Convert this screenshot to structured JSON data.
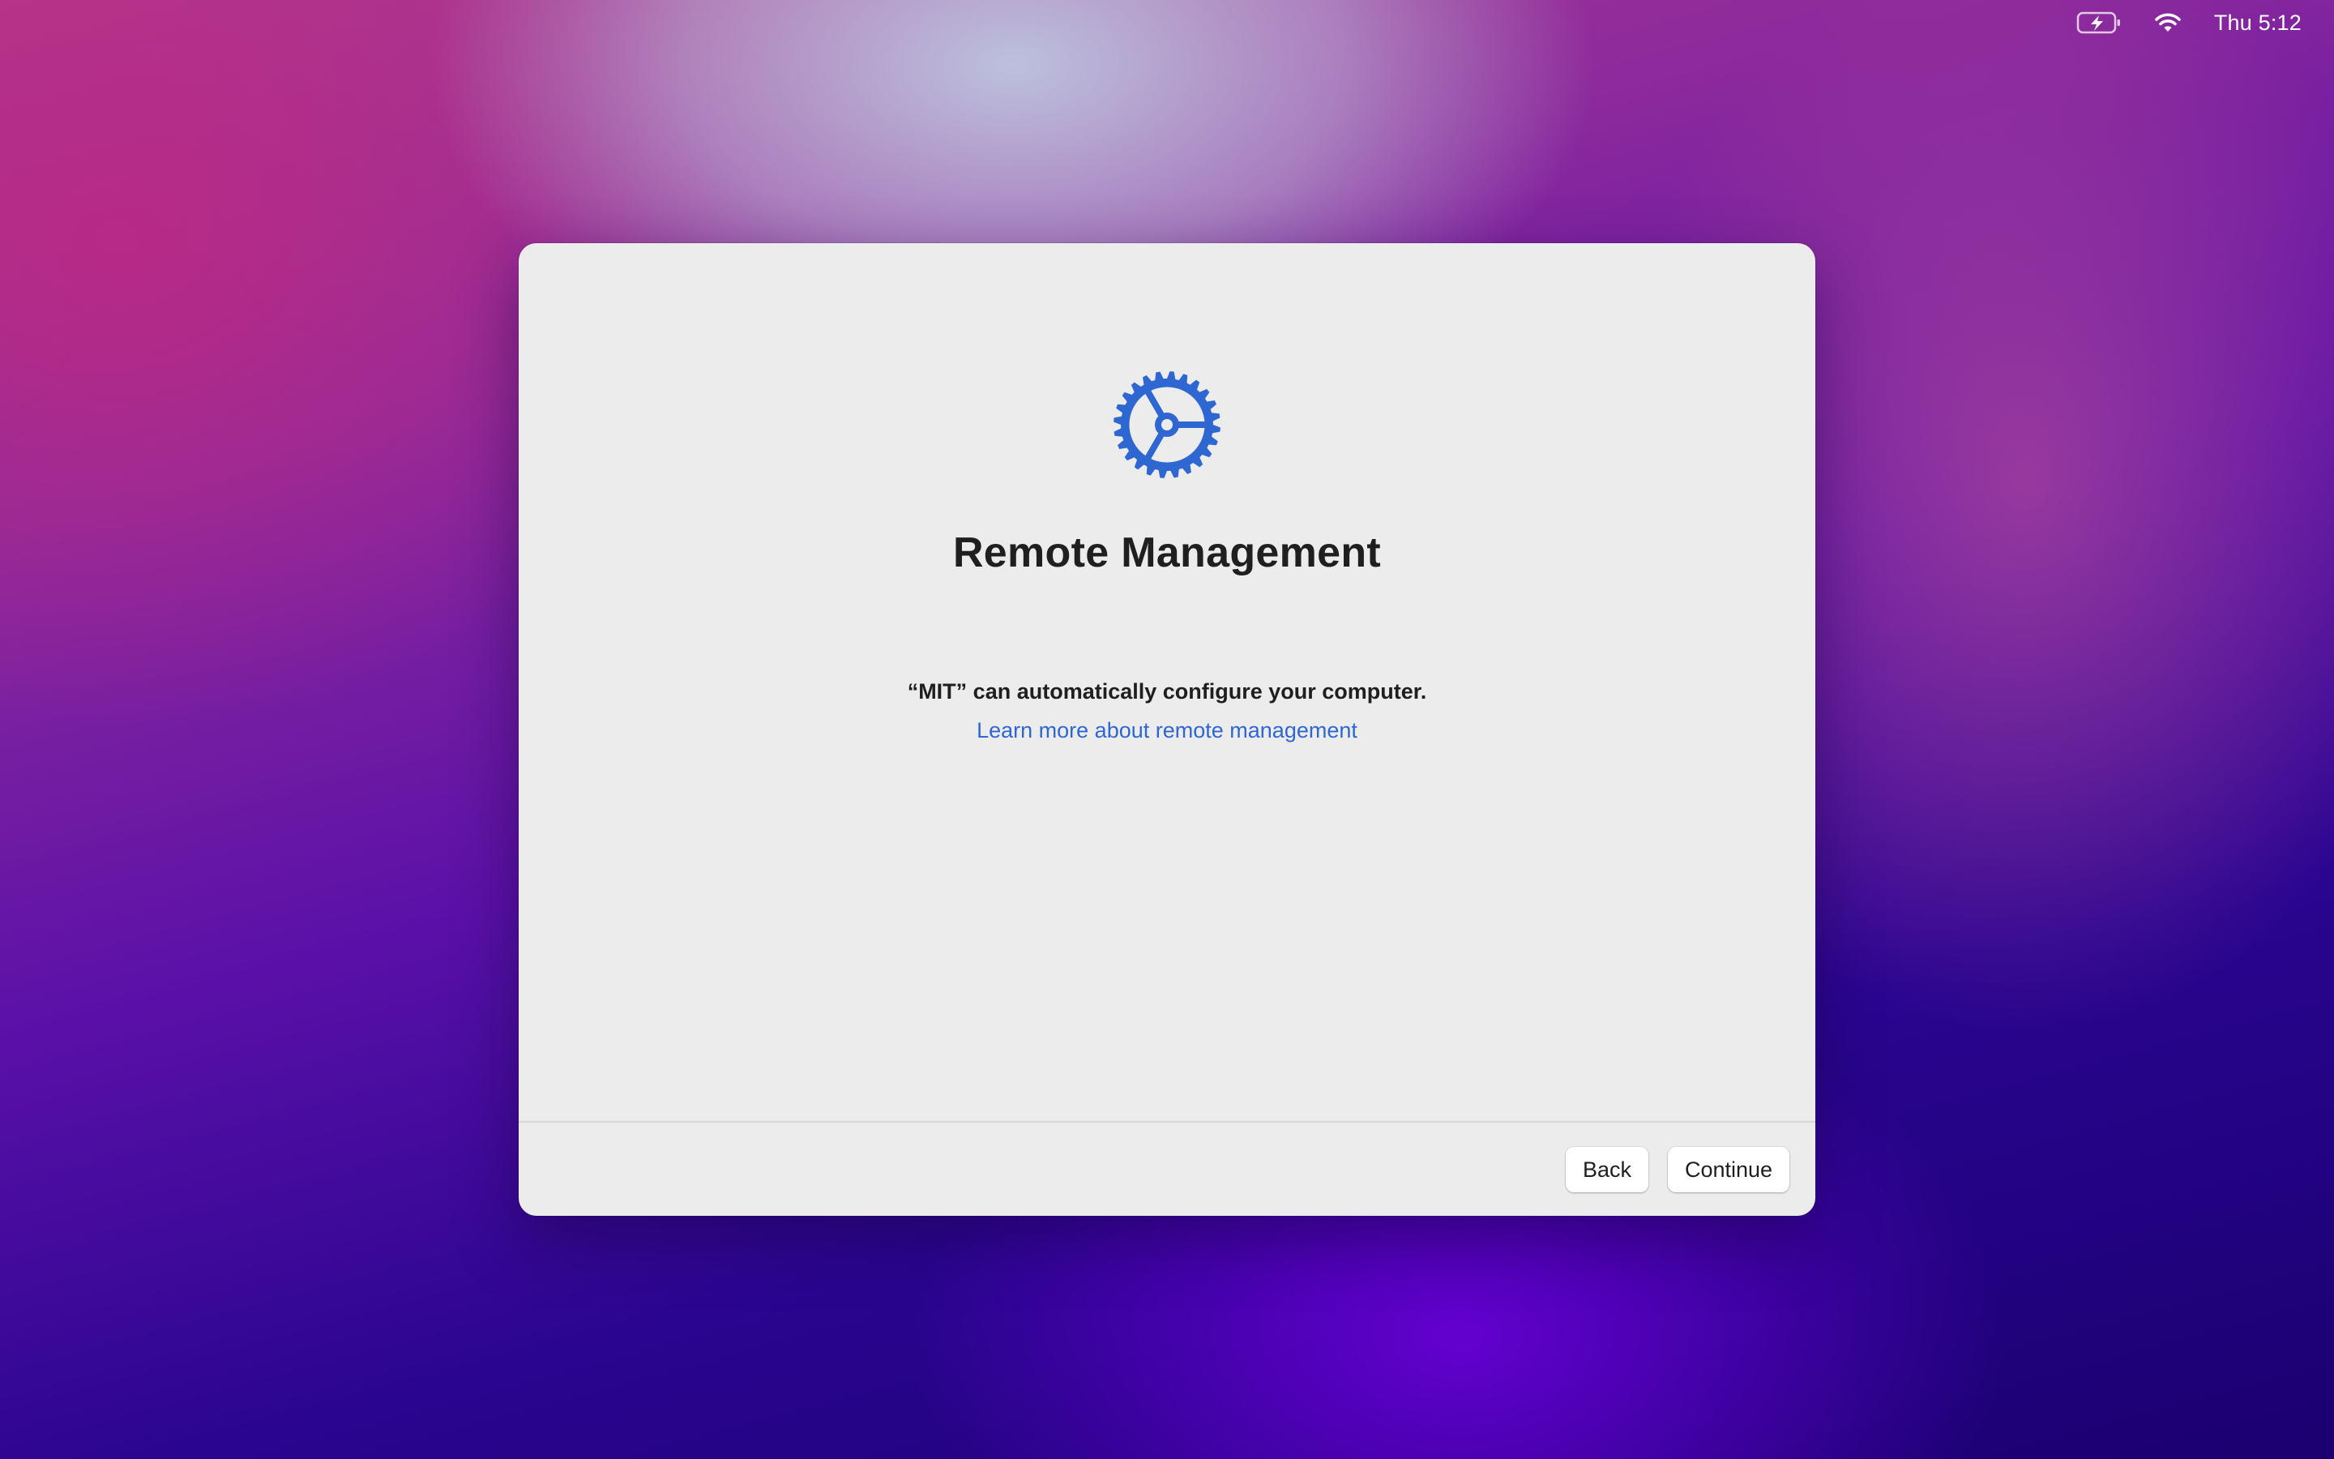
{
  "menubar": {
    "battery_icon": "battery-charging-icon",
    "wifi_icon": "wifi-icon",
    "clock": "Thu 5:12"
  },
  "dialog": {
    "icon": "gear-icon",
    "icon_color": "#2f67d2",
    "title": "Remote Management",
    "description": "“MIT” can automatically configure your computer.",
    "learn_more_link": "Learn more about remote management",
    "buttons": {
      "back": "Back",
      "continue": "Continue"
    }
  }
}
